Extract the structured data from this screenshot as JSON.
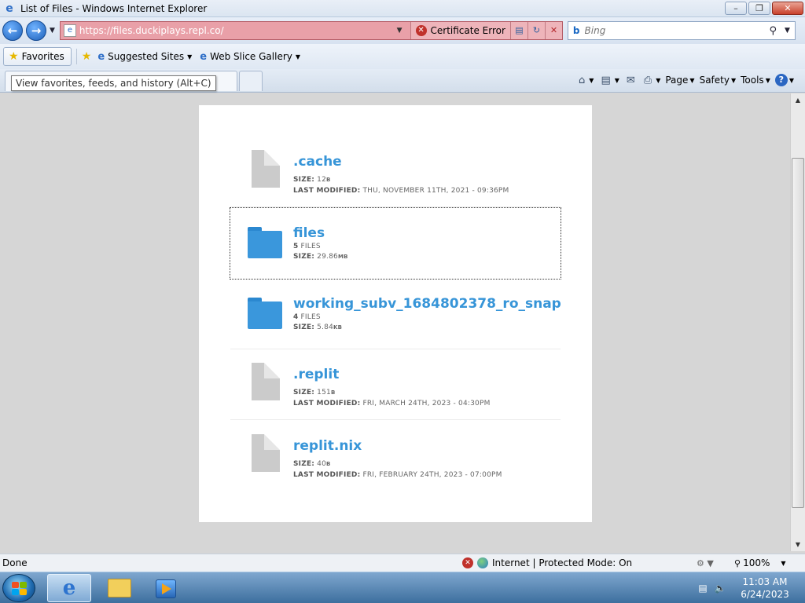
{
  "window": {
    "title": "List of Files - Windows Internet Explorer"
  },
  "address": {
    "url_prefix": "https://files.duckiplays.",
    "url_domain": "repl.co",
    "url_suffix": "/",
    "cert_error": "Certificate Error"
  },
  "search": {
    "placeholder": "Bing"
  },
  "favorites_bar": {
    "favorites_label": "Favorites",
    "suggested_sites": "Suggested Sites",
    "web_slice_gallery": "Web Slice Gallery",
    "tooltip": "View favorites, feeds, and history (Alt+C)"
  },
  "command_bar": {
    "page": "Page",
    "safety": "Safety",
    "tools": "Tools"
  },
  "files": [
    {
      "name": ".cache",
      "type": "file",
      "meta1_label": "SIZE:",
      "meta1_value": "12",
      "meta1_unit": "B",
      "meta2_label": "LAST MODIFIED:",
      "meta2_value": "THU, NOVEMBER 11TH, 2021 - 09:36PM"
    },
    {
      "name": "files",
      "type": "folder",
      "meta1_label": "",
      "meta1_value": "5",
      "meta1_unit": "FILES",
      "meta2_label": "SIZE:",
      "meta2_value": "29.86",
      "meta2_unit": "MB"
    },
    {
      "name": "working_subv_1684802378_ro_snap",
      "type": "folder",
      "meta1_label": "",
      "meta1_value": "4",
      "meta1_unit": "FILES",
      "meta2_label": "SIZE:",
      "meta2_value": "5.84",
      "meta2_unit": "KB"
    },
    {
      "name": ".replit",
      "type": "file",
      "meta1_label": "SIZE:",
      "meta1_value": "151",
      "meta1_unit": "B",
      "meta2_label": "LAST MODIFIED:",
      "meta2_value": "FRI, MARCH 24TH, 2023 - 04:30PM"
    },
    {
      "name": "replit.nix",
      "type": "file",
      "meta1_label": "SIZE:",
      "meta1_value": "40",
      "meta1_unit": "B",
      "meta2_label": "LAST MODIFIED:",
      "meta2_value": "FRI, FEBRUARY 24TH, 2023 - 07:00PM"
    }
  ],
  "status": {
    "left": "Done",
    "zone": "Internet | Protected Mode: On",
    "zoom": "100%"
  },
  "taskbar": {
    "time": "11:03 AM",
    "date": "6/24/2023"
  },
  "colors": {
    "address_error_bg": "#e9a0a8",
    "link_blue": "#3795d8",
    "folder_blue": "#3a97dc",
    "file_gray": "#cbcbcb"
  }
}
